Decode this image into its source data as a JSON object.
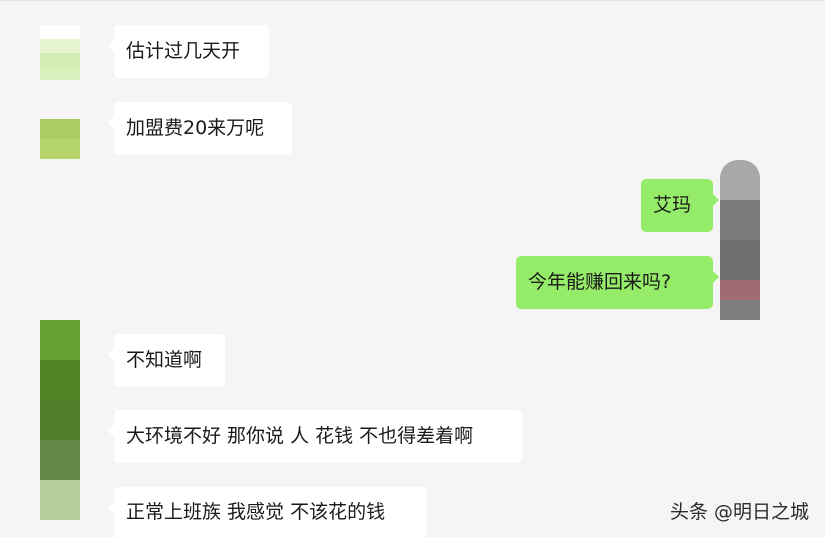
{
  "messages": [
    {
      "side": "left",
      "text": "估计过几天开"
    },
    {
      "side": "left",
      "text": "加盟费20来万呢"
    },
    {
      "side": "right",
      "text": "艾玛"
    },
    {
      "side": "right",
      "text": "今年能赚回来吗?"
    },
    {
      "side": "left",
      "text": "不知道啊"
    },
    {
      "side": "left",
      "text": "大环境不好 那你说 人 花钱 不也得差着啊"
    },
    {
      "side": "left",
      "text": "正常上班族 我感觉 不该花的钱"
    }
  ],
  "watermark": "头条 @明日之城",
  "colors": {
    "background": "#f5f5f5",
    "left_bubble": "#ffffff",
    "right_bubble": "#95ec69"
  },
  "avatars": {
    "contact_1": [
      "#ffffff",
      "#e6f4cf",
      "#d4efb6",
      "#d9f2bd"
    ],
    "contact_2": [
      "#a9cc63",
      "#b4d36b"
    ],
    "self": [
      "#a8a8a8",
      "#7a7a7a",
      "#6f6f6f",
      "#a16b73",
      "#7d7d7d"
    ],
    "contact_3": [
      "#66a033",
      "#4f8522",
      "#4f7f2a",
      "#66884a",
      "#b6cd9a"
    ]
  }
}
